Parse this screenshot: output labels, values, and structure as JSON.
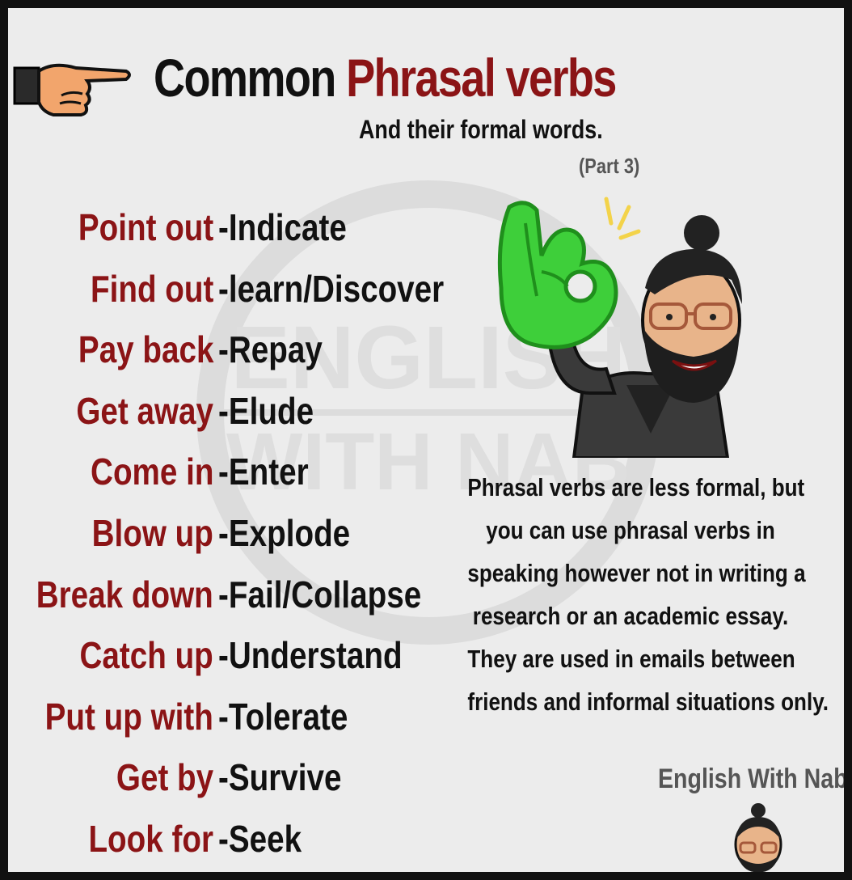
{
  "header": {
    "title_part1": "Common",
    "title_part2": "Phrasal verbs",
    "subtitle": "And their formal words.",
    "part": "(Part 3)"
  },
  "verbs": [
    {
      "phrasal": "Point out",
      "formal": "-Indicate"
    },
    {
      "phrasal": "Find out",
      "formal": "-learn/Discover"
    },
    {
      "phrasal": "Pay back",
      "formal": "-Repay"
    },
    {
      "phrasal": "Get away",
      "formal": "-Elude"
    },
    {
      "phrasal": "Come in",
      "formal": "-Enter"
    },
    {
      "phrasal": "Blow up",
      "formal": "-Explode"
    },
    {
      "phrasal": "Break down",
      "formal": "-Fail/Collapse"
    },
    {
      "phrasal": "Catch up",
      "formal": "-Understand"
    },
    {
      "phrasal": "Put up with",
      "formal": "-Tolerate"
    },
    {
      "phrasal": "Get by",
      "formal": "-Survive"
    },
    {
      "phrasal": "Look for",
      "formal": "-Seek"
    }
  ],
  "note": {
    "lines": [
      "Phrasal verbs are less formal, but",
      "you can use phrasal verbs in",
      "speaking however not in writing a",
      "research or an academic essay.",
      "They are used in emails between",
      "friends and informal situations only."
    ]
  },
  "watermark": {
    "line1": "ENGLISH",
    "line2": "WITH NAB"
  },
  "brand": "English With Nab",
  "icons": {
    "pointer": "pointing-hand-icon",
    "avatar": "cartoon-man-ok-gesture",
    "mini_avatar": "cartoon-man-head-icon"
  },
  "colors": {
    "accent": "#8b1416",
    "text": "#111111",
    "background": "#ececec",
    "glove": "#3ecf3a"
  }
}
